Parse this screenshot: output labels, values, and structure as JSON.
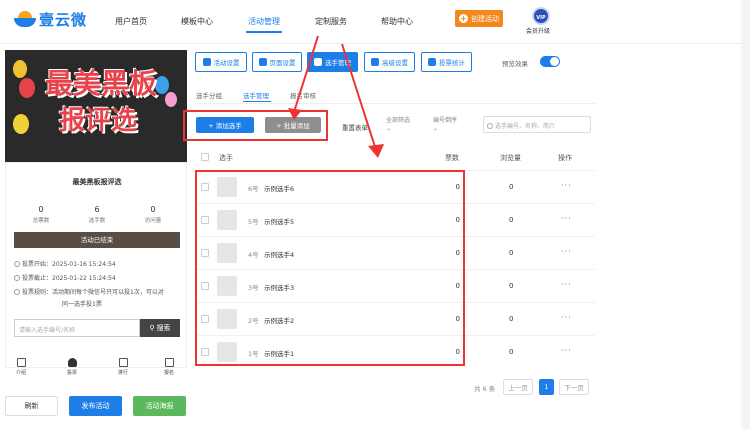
{
  "header": {
    "logo_text": "壹云微",
    "nav": [
      "用户首页",
      "模板中心",
      "活动管理",
      "定制服务",
      "帮助中心"
    ],
    "create_button": "创建活动",
    "vip_badge": "VIP",
    "vip_label": "会员升级"
  },
  "preview": {
    "poster_title_line1": "最美黑板",
    "poster_title_line2": "报评选",
    "card_title": "最美黑板报评选",
    "stats": [
      {
        "value": "0",
        "label": "总票数"
      },
      {
        "value": "6",
        "label": "选手数"
      },
      {
        "value": "0",
        "label": "访问量"
      }
    ],
    "status_bar": "活动已结束",
    "vote_start": "投票开始：2025-01-16 15:24:54",
    "vote_end": "投票截止：2025-01-22 15:24:54",
    "vote_rule_1": "投票规则：活动期间每个微信号只可以投1次，可以对",
    "vote_rule_2": "同一选手投1票",
    "search_placeholder": "请输入选手编号/名称",
    "search_button": "搜索",
    "bottom_tabs": [
      "介绍",
      "投票",
      "排行",
      "报名"
    ]
  },
  "actions": {
    "refresh": "刷新",
    "publish": "发布活动",
    "poster": "活动海报"
  },
  "toolbar": {
    "buttons": [
      "活动设置",
      "页面设置",
      "选手管理",
      "高级设置",
      "投票统计"
    ],
    "preview_effect": "预览效果"
  },
  "subtabs": [
    "选手分组",
    "选手管理",
    "报名审核"
  ],
  "filters": {
    "add_player": "+ 添加选手",
    "batch_add": "+ 批量添加",
    "reset": "重置表单",
    "filter_all": "全部筛选",
    "sort": "编号倒序",
    "search_placeholder": "选手编号、名称、简介"
  },
  "table": {
    "headers": [
      "选手",
      "票数",
      "浏览量",
      "操作"
    ],
    "rows": [
      {
        "num": "6号",
        "name": "示例选手6",
        "votes": "0",
        "views": "0",
        "more": "···"
      },
      {
        "num": "5号",
        "name": "示例选手5",
        "votes": "0",
        "views": "0",
        "more": "···"
      },
      {
        "num": "4号",
        "name": "示例选手4",
        "votes": "0",
        "views": "0",
        "more": "···"
      },
      {
        "num": "3号",
        "name": "示例选手3",
        "votes": "0",
        "views": "0",
        "more": "···"
      },
      {
        "num": "2号",
        "name": "示例选手2",
        "votes": "0",
        "views": "0",
        "more": "···"
      },
      {
        "num": "1号",
        "name": "示例选手1",
        "votes": "0",
        "views": "0",
        "more": "···"
      }
    ]
  },
  "pagination": {
    "total": "共 6 条",
    "prev": "上一页",
    "current": "1",
    "next": "下一页"
  },
  "colors": {
    "primary": "#1e7ee8",
    "accent_orange": "#f5871f",
    "annotation_red": "#e33333",
    "publish_green": "#5cb85c"
  }
}
